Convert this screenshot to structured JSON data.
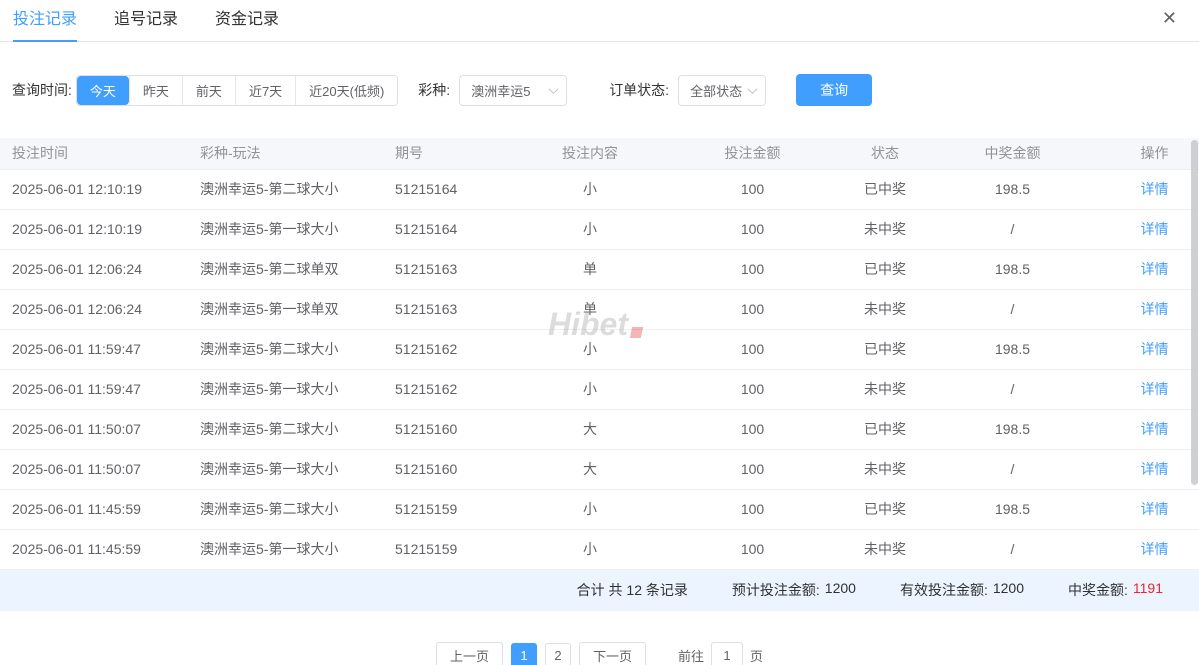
{
  "window": {
    "close_icon": "✕"
  },
  "tabs": [
    {
      "label": "投注记录",
      "active": true
    },
    {
      "label": "追号记录",
      "active": false
    },
    {
      "label": "资金记录",
      "active": false
    }
  ],
  "filters": {
    "time_label": "查询时间:",
    "time_options": [
      {
        "label": "今天",
        "active": true
      },
      {
        "label": "昨天",
        "active": false
      },
      {
        "label": "前天",
        "active": false
      },
      {
        "label": "近7天",
        "active": false
      },
      {
        "label": "近20天(低频)",
        "active": false
      }
    ],
    "lottery_label": "彩种:",
    "lottery_value": "澳洲幸运5",
    "status_label": "订单状态:",
    "status_value": "全部状态",
    "query_button": "查询"
  },
  "table": {
    "headers": [
      "投注时间",
      "彩种-玩法",
      "期号",
      "投注内容",
      "投注金额",
      "状态",
      "中奖金额",
      "操作"
    ],
    "rows": [
      {
        "time": "2025-06-01 12:10:19",
        "game": "澳洲幸运5-第二球大小",
        "issue": "51215164",
        "content": "小",
        "amount": "100",
        "status": "已中奖",
        "won": true,
        "win_amount": "198.5",
        "action": "详情"
      },
      {
        "time": "2025-06-01 12:10:19",
        "game": "澳洲幸运5-第一球大小",
        "issue": "51215164",
        "content": "小",
        "amount": "100",
        "status": "未中奖",
        "won": false,
        "win_amount": "/",
        "action": "详情"
      },
      {
        "time": "2025-06-01 12:06:24",
        "game": "澳洲幸运5-第二球单双",
        "issue": "51215163",
        "content": "单",
        "amount": "100",
        "status": "已中奖",
        "won": true,
        "win_amount": "198.5",
        "action": "详情"
      },
      {
        "time": "2025-06-01 12:06:24",
        "game": "澳洲幸运5-第一球单双",
        "issue": "51215163",
        "content": "单",
        "amount": "100",
        "status": "未中奖",
        "won": false,
        "win_amount": "/",
        "action": "详情"
      },
      {
        "time": "2025-06-01 11:59:47",
        "game": "澳洲幸运5-第二球大小",
        "issue": "51215162",
        "content": "小",
        "amount": "100",
        "status": "已中奖",
        "won": true,
        "win_amount": "198.5",
        "action": "详情"
      },
      {
        "time": "2025-06-01 11:59:47",
        "game": "澳洲幸运5-第一球大小",
        "issue": "51215162",
        "content": "小",
        "amount": "100",
        "status": "未中奖",
        "won": false,
        "win_amount": "/",
        "action": "详情"
      },
      {
        "time": "2025-06-01 11:50:07",
        "game": "澳洲幸运5-第二球大小",
        "issue": "51215160",
        "content": "大",
        "amount": "100",
        "status": "已中奖",
        "won": true,
        "win_amount": "198.5",
        "action": "详情"
      },
      {
        "time": "2025-06-01 11:50:07",
        "game": "澳洲幸运5-第一球大小",
        "issue": "51215160",
        "content": "大",
        "amount": "100",
        "status": "未中奖",
        "won": false,
        "win_amount": "/",
        "action": "详情"
      },
      {
        "time": "2025-06-01 11:45:59",
        "game": "澳洲幸运5-第二球大小",
        "issue": "51215159",
        "content": "小",
        "amount": "100",
        "status": "已中奖",
        "won": true,
        "win_amount": "198.5",
        "action": "详情"
      },
      {
        "time": "2025-06-01 11:45:59",
        "game": "澳洲幸运5-第一球大小",
        "issue": "51215159",
        "content": "小",
        "amount": "100",
        "status": "未中奖",
        "won": false,
        "win_amount": "/",
        "action": "详情"
      }
    ]
  },
  "summary": {
    "total": "合计 共 12 条记录",
    "expected_label": "预计投注金额:",
    "expected_value": "1200",
    "valid_label": "有效投注金额:",
    "valid_value": "1200",
    "win_label": "中奖金额:",
    "win_value": "1191"
  },
  "pagination": {
    "prev_label": "上一页",
    "pages": [
      {
        "label": "1",
        "active": true
      },
      {
        "label": "2",
        "active": false
      }
    ],
    "next_label": "下一页",
    "goto_label": "前往",
    "goto_value": "1",
    "goto_suffix": "页"
  },
  "watermark": {
    "text": "Hibet"
  },
  "colors": {
    "accent_blue": "#409eff",
    "win_red": "#f5222d",
    "header_text": "#909399",
    "row_text": "#606266",
    "summary_bg": "#ecf5ff",
    "border": "#ebeef5"
  }
}
